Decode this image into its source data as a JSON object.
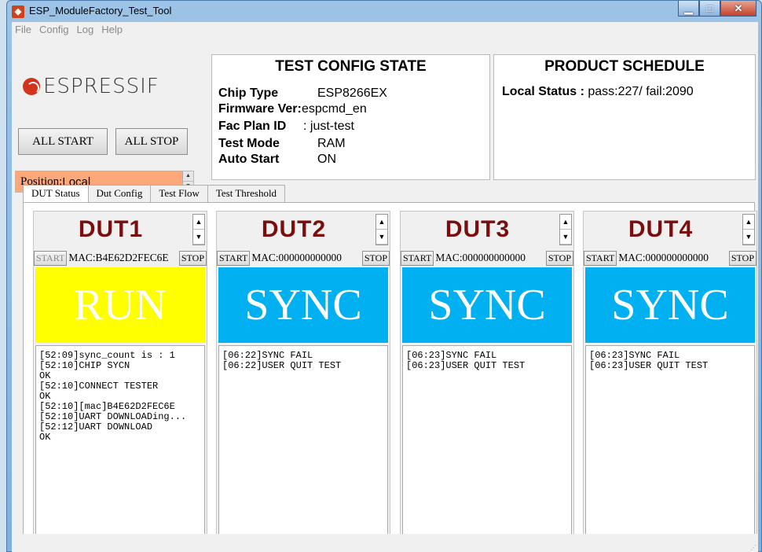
{
  "window": {
    "title": "ESP_ModuleFactory_Test_Tool"
  },
  "menu": [
    "File",
    "Config",
    "Log",
    "Help"
  ],
  "logo": {
    "text": "ESPRESSIF"
  },
  "buttons": {
    "all_start": "ALL START",
    "all_stop": "ALL STOP"
  },
  "position": {
    "label": "Position:",
    "value": "Local"
  },
  "test_config": {
    "title": "TEST CONFIG STATE",
    "rows": [
      {
        "key": "Chip Type",
        "value": "ESP8266EX"
      },
      {
        "key": "Firmware Ver:",
        "value": "espcmd_en"
      },
      {
        "key": "Fac Plan ID",
        "value": ": just-test"
      },
      {
        "key": "Test Mode",
        "value": "RAM"
      },
      {
        "key": "Auto Start",
        "value": "ON"
      }
    ]
  },
  "product_schedule": {
    "title": "PRODUCT SCHEDULE",
    "status_label": "Local Status :",
    "status_value": "pass:227/ fail:2090"
  },
  "tabs": [
    "DUT Status",
    "Dut Config",
    "Test Flow",
    "Test Threshold"
  ],
  "colors": {
    "run": "#ffff00",
    "sync": "#00b0f0",
    "position_bg": "#fca879",
    "dut_title": "#7a0d0d"
  },
  "duts": [
    {
      "name": "DUT1",
      "start": "START",
      "mac": "MAC:B4E62D2FEC6E",
      "stop": "STOP",
      "state": "RUN",
      "state_color": "#ffff00",
      "log": "[52:09]sync_count is : 1\n[52:10]CHIP SYCN\nOK\n[52:10]CONNECT TESTER\nOK\n[52:10][mac]B4E62D2FEC6E\n[52:10]UART DOWNLOADing...\n[52:12]UART DOWNLOAD\nOK"
    },
    {
      "name": "DUT2",
      "start": "START",
      "mac": "MAC:000000000000",
      "stop": "STOP",
      "state": "SYNC",
      "state_color": "#00b0f0",
      "log": "[06:22]SYNC FAIL\n[06:22]USER QUIT TEST"
    },
    {
      "name": "DUT3",
      "start": "START",
      "mac": "MAC:000000000000",
      "stop": "STOP",
      "state": "SYNC",
      "state_color": "#00b0f0",
      "log": "[06:23]SYNC FAIL\n[06:23]USER QUIT TEST"
    },
    {
      "name": "DUT4",
      "start": "START",
      "mac": "MAC:000000000000",
      "stop": "STOP",
      "state": "SYNC",
      "state_color": "#00b0f0",
      "log": "[06:23]SYNC FAIL\n[06:23]USER QUIT TEST"
    }
  ]
}
